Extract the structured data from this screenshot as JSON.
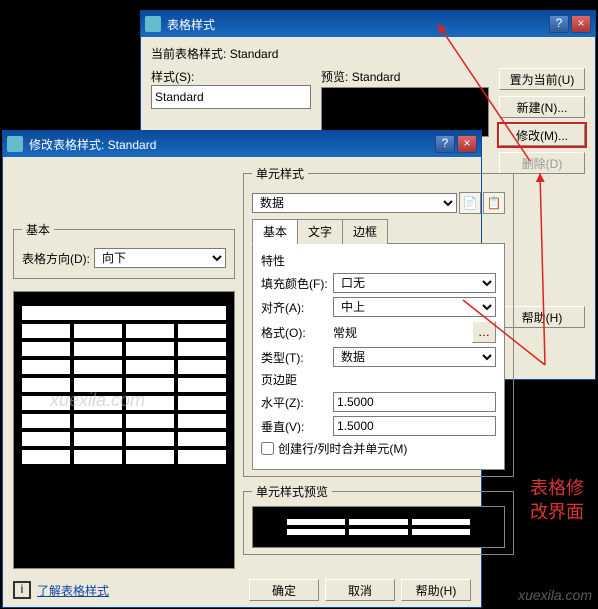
{
  "back_window": {
    "title": "表格样式",
    "current_style_label": "当前表格样式:",
    "current_style_value": "Standard",
    "style_label": "样式(S):",
    "style_value": "Standard",
    "preview_label": "预览:",
    "preview_value": "Standard",
    "buttons": {
      "set_current": "置为当前(U)",
      "new": "新建(N)...",
      "modify": "修改(M)...",
      "delete": "删除(D)",
      "help": "帮助(H)"
    }
  },
  "front_window": {
    "title": "修改表格样式: Standard",
    "basic_group": "基本",
    "table_direction_label": "表格方向(D):",
    "table_direction_value": "向下",
    "cell_style_group": "单元样式",
    "cell_style_value": "数据",
    "tabs": {
      "basic": "基本",
      "text": "文字",
      "border": "边框"
    },
    "properties_group": "特性",
    "fill_color_label": "填充颜色(F):",
    "fill_color_value": "口无",
    "align_label": "对齐(A):",
    "align_value": "中上",
    "format_label": "格式(O):",
    "format_value": "常规",
    "type_label": "类型(T):",
    "type_value": "数据",
    "margin_group": "页边距",
    "horiz_label": "水平(Z):",
    "horiz_value": "1.5000",
    "vert_label": "垂直(V):",
    "vert_value": "1.5000",
    "merge_checkbox": "创建行/列时合并单元(M)",
    "cell_preview_label": "单元样式预览",
    "learn_link": "了解表格样式",
    "ok": "确定",
    "cancel": "取消",
    "help": "帮助(H)"
  },
  "annotation": "表格修\n改界面",
  "watermark": "xuexila.com"
}
